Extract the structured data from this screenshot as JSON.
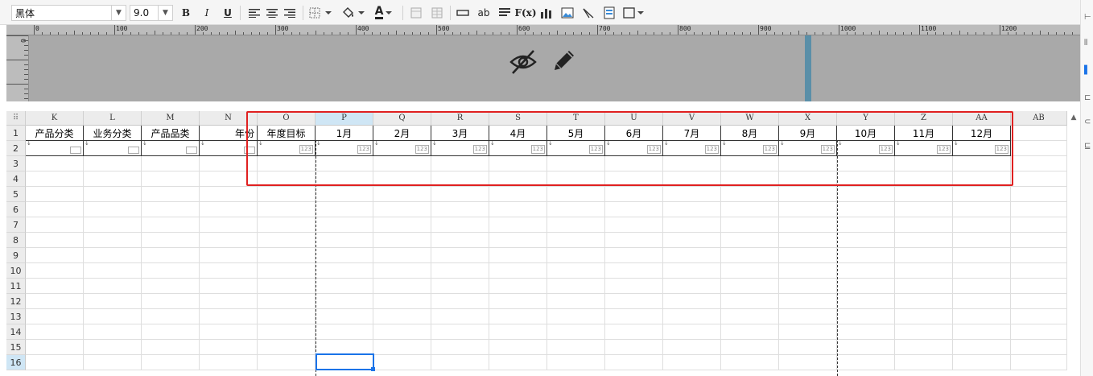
{
  "toolbar": {
    "font_name": "黑体",
    "font_size": "9.0",
    "bold": "B",
    "italic": "I",
    "underline": "U",
    "font_color": "A",
    "text_wrap": "ab",
    "formula": "F(x)"
  },
  "ruler": {
    "labels": [
      "0",
      "100",
      "200",
      "300",
      "400",
      "500",
      "600",
      "700",
      "800",
      "900",
      "1000",
      "1100",
      "1200"
    ],
    "vertical_label": "0"
  },
  "columns": [
    "K",
    "L",
    "M",
    "N",
    "O",
    "P",
    "Q",
    "R",
    "S",
    "T",
    "U",
    "V",
    "W",
    "X",
    "Y",
    "Z",
    "AA",
    "AB"
  ],
  "rows": [
    "1",
    "2",
    "3",
    "4",
    "5",
    "6",
    "7",
    "8",
    "9",
    "10",
    "11",
    "12",
    "13",
    "14",
    "15",
    "16"
  ],
  "header_cells": [
    "产品分类",
    "业务分类",
    "产品品类",
    "年份",
    "年度目标",
    "1月",
    "2月",
    "3月",
    "4月",
    "5月",
    "6月",
    "7月",
    "8月",
    "9月",
    "10月",
    "11月",
    "12月"
  ],
  "number_tag": "123",
  "selected_column": "P",
  "selected_row": "16",
  "colors": {
    "highlight_border": "#e02020",
    "selection": "#1a73e8",
    "canvas": "#a9a9a9"
  }
}
